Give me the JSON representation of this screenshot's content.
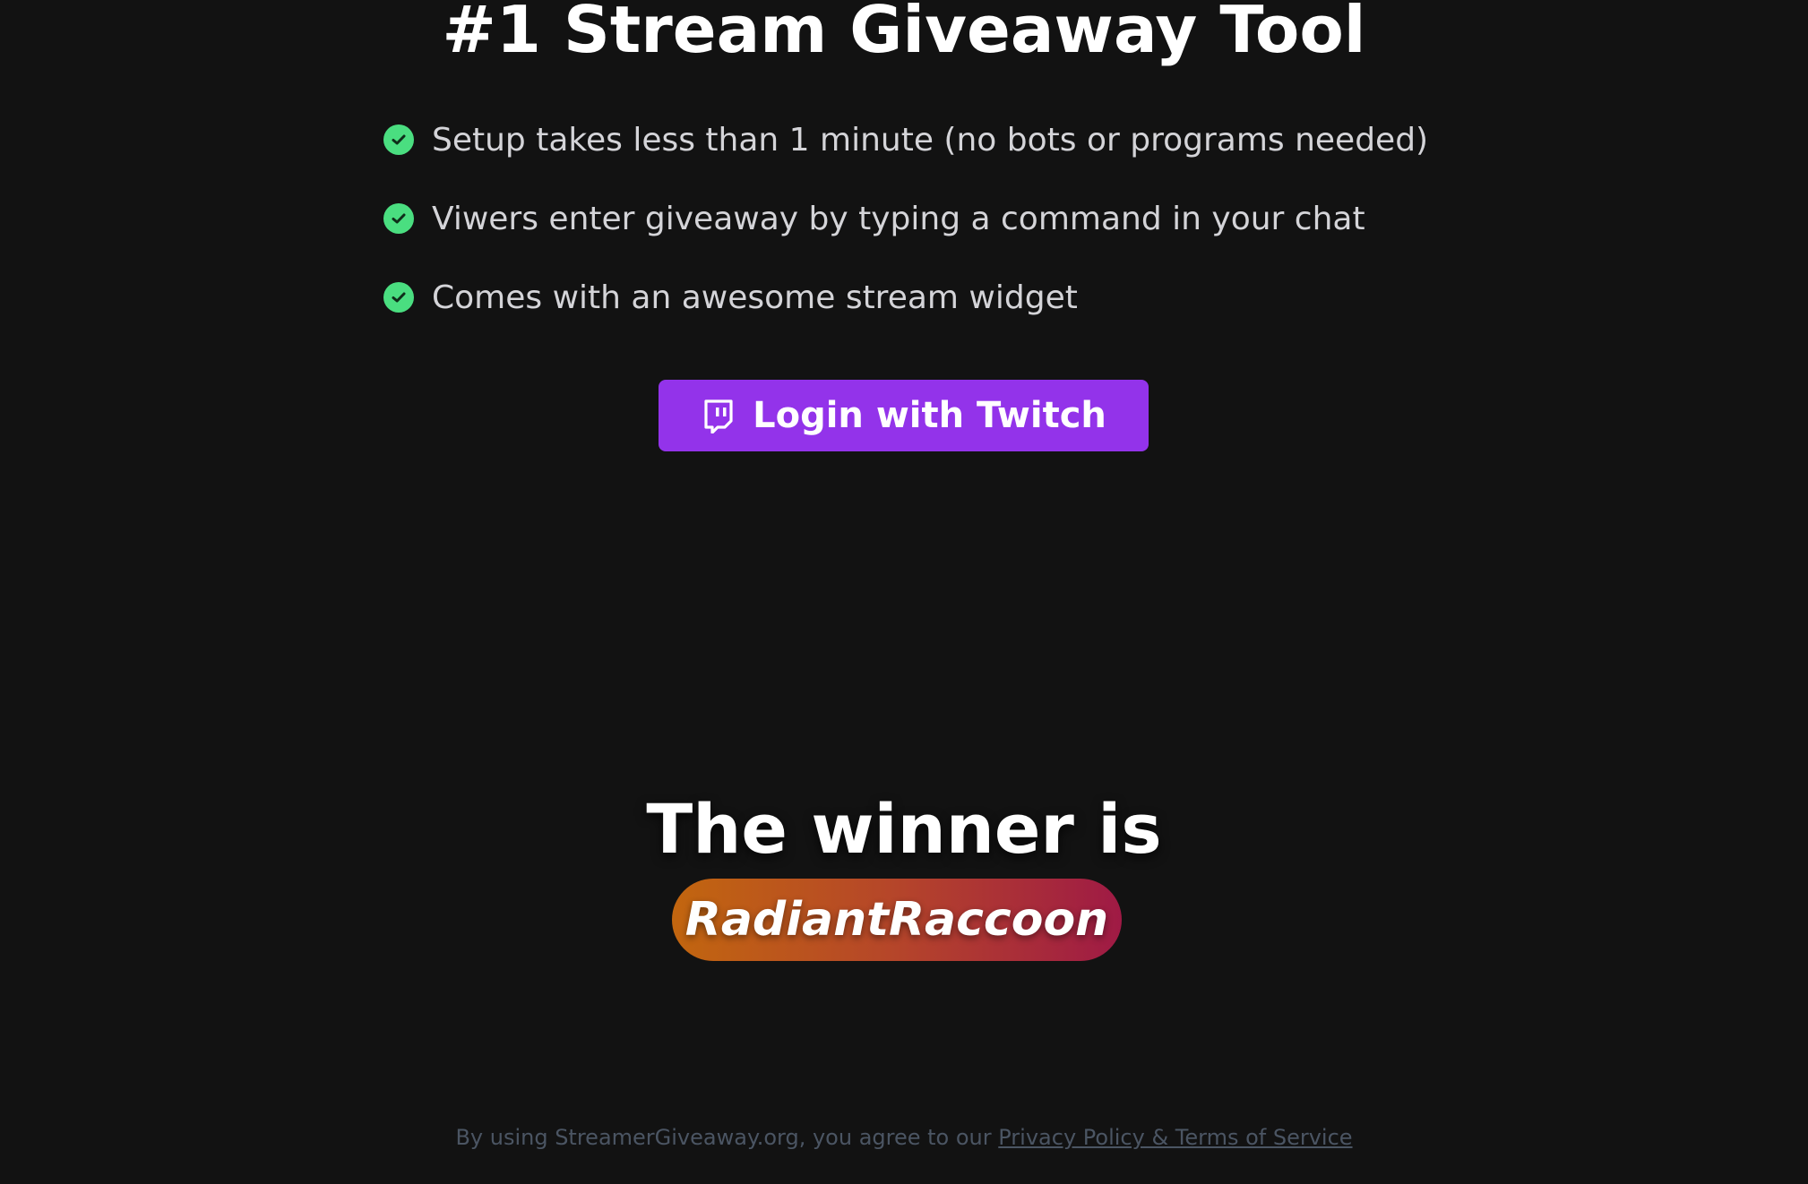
{
  "hero": {
    "title": "#1 Stream Giveaway Tool"
  },
  "features": [
    {
      "text": "Setup takes less than 1 minute (no bots or programs needed)",
      "icon": "check-circle-icon"
    },
    {
      "text": "Viwers enter giveaway by typing a command in your chat",
      "icon": "check-circle-icon"
    },
    {
      "text": "Comes with an awesome stream widget",
      "icon": "check-circle-icon"
    }
  ],
  "login": {
    "label": "Login with Twitch",
    "icon": "twitch-icon"
  },
  "winner": {
    "title": "The winner is",
    "name": "RadiantRaccoon"
  },
  "footer": {
    "text": "By using StreamerGiveaway.org, you agree to our ",
    "link": "Privacy Policy & Terms of Service"
  },
  "colors": {
    "background": "#121212",
    "accent": "#9333ea",
    "check": "#4ade80",
    "badge_start": "#c2660f",
    "badge_end": "#9f1a45"
  }
}
